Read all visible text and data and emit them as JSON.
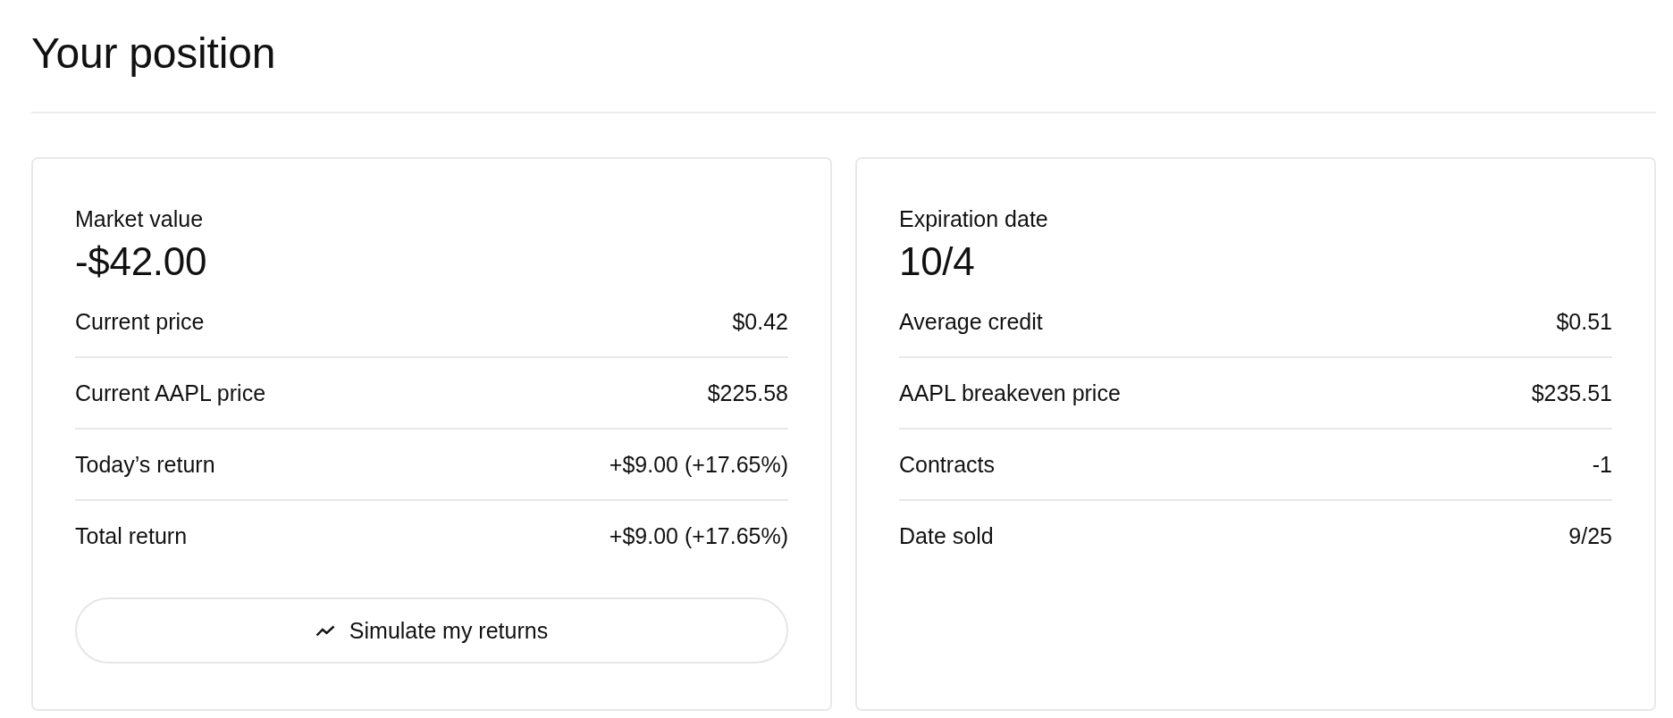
{
  "title": "Your position",
  "cards": [
    {
      "label": "Market value",
      "value": "-$42.00",
      "rows": [
        {
          "label": "Current price",
          "value": "$0.42"
        },
        {
          "label": "Current AAPL price",
          "value": "$225.58"
        },
        {
          "label": "Today’s return",
          "value": "+$9.00 (+17.65%)"
        },
        {
          "label": "Total return",
          "value": "+$9.00 (+17.65%)"
        }
      ],
      "button": {
        "label": "Simulate my returns"
      }
    },
    {
      "label": "Expiration date",
      "value": "10/4",
      "rows": [
        {
          "label": "Average credit",
          "value": "$0.51"
        },
        {
          "label": "AAPL breakeven price",
          "value": "$235.51"
        },
        {
          "label": "Contracts",
          "value": "-1"
        },
        {
          "label": "Date sold",
          "value": "9/25"
        }
      ]
    }
  ]
}
